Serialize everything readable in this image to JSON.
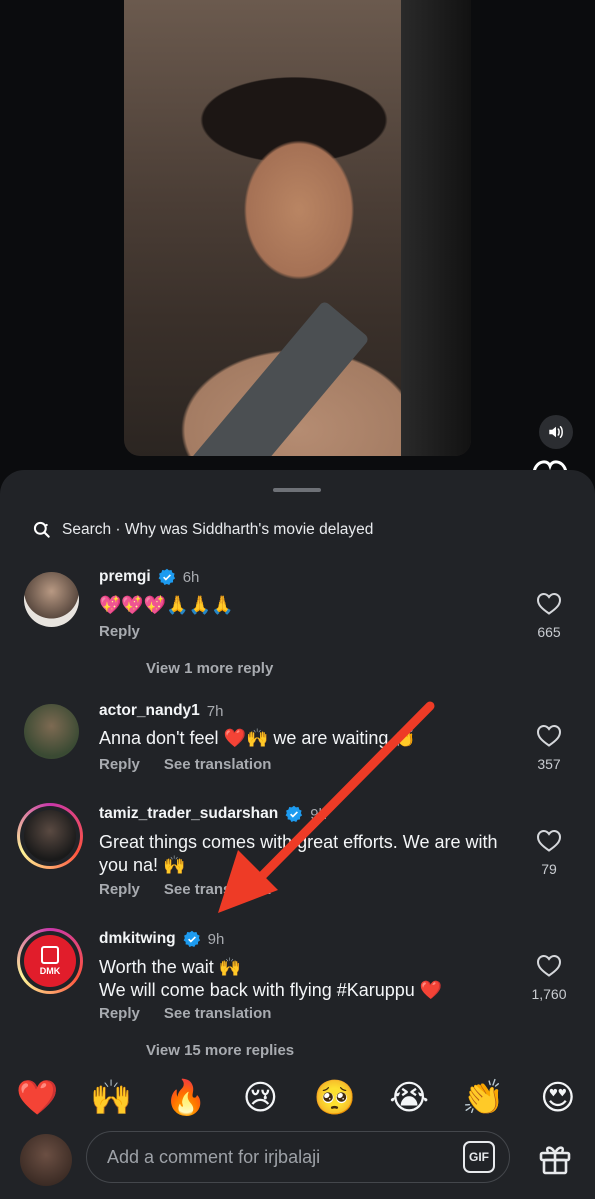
{
  "search": {
    "text": "Search · Why was Siddharth's movie delayed"
  },
  "comments": [
    {
      "username": "premgi",
      "verified": true,
      "time": "6h",
      "text": "💖💖💖🙏🙏🙏",
      "reply": "Reply",
      "see_translation": "",
      "likes": "665",
      "view_more": "View 1 more reply"
    },
    {
      "username": "actor_nandy1",
      "verified": false,
      "time": "7h",
      "text": "Anna don't feel ❤️🙌 we are waiting 👏",
      "reply": "Reply",
      "see_translation": "See translation",
      "likes": "357"
    },
    {
      "username": "tamiz_trader_sudarshan",
      "verified": true,
      "time": "9h",
      "text": "Great things comes with great efforts. We are with you na! 🙌",
      "reply": "Reply",
      "see_translation": "See translation",
      "likes": "79"
    },
    {
      "username": "dmkitwing",
      "verified": true,
      "time": "9h",
      "text_line1": "Worth the wait 🙌",
      "text_line2": "We will come back with flying #Karuppu ❤️",
      "reply": "Reply",
      "see_translation": "See translation",
      "likes": "1,760",
      "avatar_text": "DMK",
      "view_more": "View 15 more replies"
    }
  ],
  "emojis": [
    "❤️",
    "🙌",
    "🔥",
    "😢",
    "🥺",
    "😭",
    "👏",
    "😍"
  ],
  "composer": {
    "placeholder": "Add a comment for irjbalaji",
    "gif_label": "GIF"
  },
  "colors": {
    "sheet": "#212327",
    "background": "#0b0c0e",
    "verified": "#1d9bf0",
    "arrow": "#ee3b26",
    "story_ring": "#c837ab"
  }
}
